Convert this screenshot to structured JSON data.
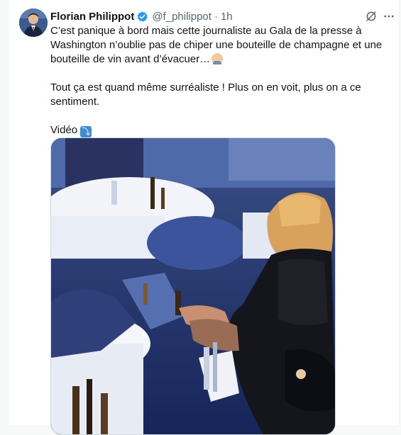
{
  "tweet": {
    "author_name": "Florian Philippot",
    "handle": "@f_philippot",
    "separator": "·",
    "time": "1h",
    "paragraph1": "C’est panique à bord mais cette journaliste au Gala de la presse à Washington n’oublie pas de chiper une bouteille de champagne et une bouteille de vin avant d’évacuer…",
    "paragraph2": "Tout ça est quand même surréaliste ! Plus on en voit, plus on a ce sentiment.",
    "paragraph3": "Vidéo",
    "verified_color": "#1d9bf0",
    "icons": {
      "verified": "verified-badge-icon",
      "grok": "grok-icon",
      "more": "more-icon",
      "face_emoji": "man-facepalming-emoji",
      "arrow_emoji": "right-arrow-curving-down-emoji"
    }
  }
}
